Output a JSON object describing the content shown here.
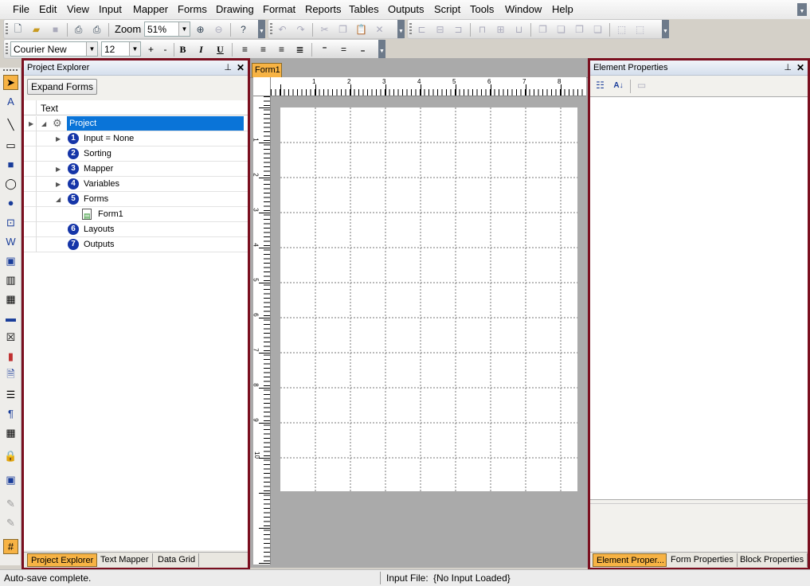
{
  "menu": [
    "File",
    "Edit",
    "View",
    "Input",
    "Mapper",
    "Forms",
    "Drawing",
    "Format",
    "Reports",
    "Tables",
    "Outputs",
    "Script",
    "Tools",
    "Window",
    "Help"
  ],
  "toolbar": {
    "zoom_label": "Zoom",
    "zoom_value": "51%",
    "font_family": "Courier New",
    "font_size": "12",
    "grow_font": "+",
    "shrink_font": "-",
    "bold": "B",
    "italic": "I",
    "underline": "U"
  },
  "project_explorer": {
    "title": "Project Explorer",
    "expand_button": "Expand Forms",
    "column_header": "Text",
    "root": "Project",
    "items": [
      {
        "num": "1",
        "label": "Input = None"
      },
      {
        "num": "2",
        "label": "Sorting"
      },
      {
        "num": "3",
        "label": "Mapper"
      },
      {
        "num": "4",
        "label": "Variables"
      },
      {
        "num": "5",
        "label": "Forms"
      },
      {
        "num": "",
        "label": "Form1"
      },
      {
        "num": "6",
        "label": "Layouts"
      },
      {
        "num": "7",
        "label": "Outputs"
      }
    ],
    "tabs": [
      "Project Explorer",
      "Text Mapper",
      "Data Grid"
    ]
  },
  "document": {
    "tab": "Form1",
    "hruler_ticks": [
      "1",
      "2",
      "3",
      "4",
      "5",
      "6",
      "7",
      "8"
    ],
    "vruler_ticks": [
      "1",
      "2",
      "3",
      "4",
      "5",
      "6",
      "7",
      "8",
      "9",
      "10"
    ]
  },
  "element_properties": {
    "title": "Element Properties",
    "tabs": [
      "Element Proper...",
      "Form Properties",
      "Block Properties"
    ]
  },
  "status": {
    "message": "Auto-save complete.",
    "input_file_label": "Input File:",
    "input_file_value": "{No Input Loaded}"
  },
  "colors": {
    "panel_border": "#7a0f1f",
    "active_tab": "#f7b344",
    "tree_selected": "#0a74d8",
    "number_badge": "#1535a8"
  }
}
